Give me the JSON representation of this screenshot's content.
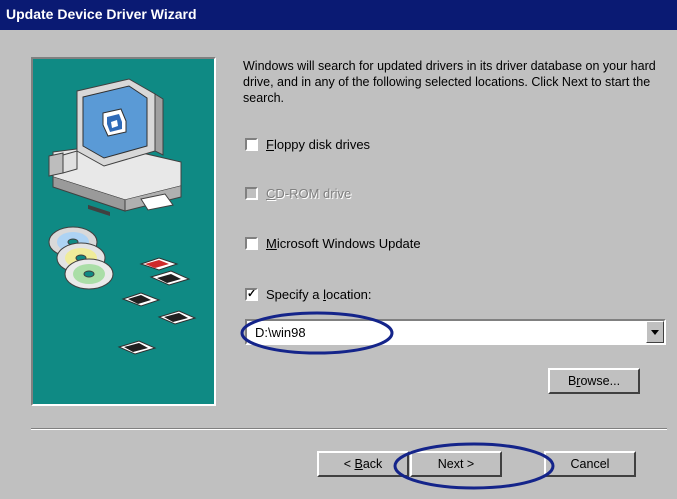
{
  "window": {
    "title": "Update Device Driver Wizard"
  },
  "intro_text": "Windows will search for updated drivers in its driver database on your hard drive, and in any of the following selected locations. Click Next to start the search.",
  "options": [
    {
      "first": "F",
      "rest": "loppy disk drives",
      "checked": false,
      "enabled": true
    },
    {
      "first": "C",
      "rest": "D-ROM drive",
      "checked": false,
      "enabled": false
    },
    {
      "first": "M",
      "rest": "icrosoft Windows Update",
      "checked": false,
      "enabled": true
    },
    {
      "pre": "Specify a ",
      "first": "l",
      "rest": "ocation:",
      "checked": true,
      "enabled": true
    }
  ],
  "location": {
    "value": "D:\\win98"
  },
  "buttons": {
    "browse": {
      "pre": "B",
      "ul": "r",
      "post": "owse..."
    },
    "back": {
      "pre": "< ",
      "ul": "B",
      "post": "ack"
    },
    "next": {
      "pre": "Next >"
    },
    "cancel": {
      "pre": "Cancel"
    }
  },
  "colors": {
    "titlebar": "#0a1a73",
    "panel_teal": "#0f8a84",
    "annotation": "#14248a"
  },
  "icons": [
    "computer-icon",
    "cd-disc-icon",
    "floppy-disk-icon",
    "checkbox-icon",
    "dropdown-arrow-icon"
  ]
}
